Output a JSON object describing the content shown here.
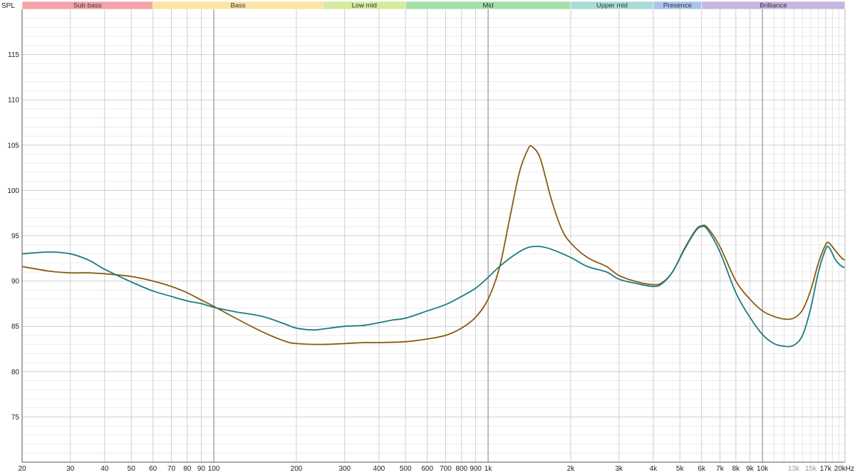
{
  "chart_data": {
    "type": "line",
    "ylabel": "SPL",
    "x_scale": "log",
    "xlim": [
      20,
      20000
    ],
    "ylim": [
      70,
      120
    ],
    "y_major_ticks": [
      75,
      80,
      85,
      90,
      95,
      100,
      105,
      110,
      115
    ],
    "x_tick_labels": [
      {
        "value": 20,
        "label": "20"
      },
      {
        "value": 30,
        "label": "30"
      },
      {
        "value": 40,
        "label": "40"
      },
      {
        "value": 50,
        "label": "50"
      },
      {
        "value": 60,
        "label": "60"
      },
      {
        "value": 70,
        "label": "70"
      },
      {
        "value": 80,
        "label": "80"
      },
      {
        "value": 90,
        "label": "90"
      },
      {
        "value": 100,
        "label": "100"
      },
      {
        "value": 200,
        "label": "200"
      },
      {
        "value": 300,
        "label": "300"
      },
      {
        "value": 400,
        "label": "400"
      },
      {
        "value": 500,
        "label": "500"
      },
      {
        "value": 600,
        "label": "600"
      },
      {
        "value": 700,
        "label": "700"
      },
      {
        "value": 800,
        "label": "800"
      },
      {
        "value": 900,
        "label": "900"
      },
      {
        "value": 1000,
        "label": "1k"
      },
      {
        "value": 2000,
        "label": "2k"
      },
      {
        "value": 3000,
        "label": "3k"
      },
      {
        "value": 4000,
        "label": "4k"
      },
      {
        "value": 5000,
        "label": "5k"
      },
      {
        "value": 6000,
        "label": "6k"
      },
      {
        "value": 7000,
        "label": "7k"
      },
      {
        "value": 8000,
        "label": "8k"
      },
      {
        "value": 9000,
        "label": "9k"
      },
      {
        "value": 10000,
        "label": "10k"
      },
      {
        "value": 13000,
        "label": "13k",
        "faint": true
      },
      {
        "value": 15000,
        "label": "15k",
        "faint": true
      },
      {
        "value": 17000,
        "label": "17k"
      },
      {
        "value": 20000,
        "label": "20kHz"
      }
    ],
    "bands": [
      {
        "label": "Sub bass",
        "from": 20,
        "to": 60,
        "color": "#f5a3a8"
      },
      {
        "label": "Bass",
        "from": 60,
        "to": 250,
        "color": "#fbe4a6"
      },
      {
        "label": "Low mid",
        "from": 250,
        "to": 500,
        "color": "#d3ec9e"
      },
      {
        "label": "Mid",
        "from": 500,
        "to": 2000,
        "color": "#a5e0a9"
      },
      {
        "label": "Upper mid",
        "from": 2000,
        "to": 4000,
        "color": "#a8dcd6"
      },
      {
        "label": "Presence",
        "from": 4000,
        "to": 6000,
        "color": "#a9c3ea"
      },
      {
        "label": "Brilliance",
        "from": 6000,
        "to": 20000,
        "color": "#c6b6e0"
      }
    ],
    "grid": true,
    "series": [
      {
        "color": "#8a5a12",
        "points": [
          [
            20,
            91.6
          ],
          [
            25,
            91.1
          ],
          [
            30,
            90.9
          ],
          [
            35,
            90.9
          ],
          [
            40,
            90.8
          ],
          [
            50,
            90.5
          ],
          [
            60,
            90.0
          ],
          [
            70,
            89.4
          ],
          [
            80,
            88.7
          ],
          [
            90,
            87.9
          ],
          [
            100,
            87.2
          ],
          [
            120,
            85.9
          ],
          [
            150,
            84.4
          ],
          [
            180,
            83.4
          ],
          [
            200,
            83.1
          ],
          [
            250,
            83.0
          ],
          [
            300,
            83.1
          ],
          [
            350,
            83.2
          ],
          [
            400,
            83.2
          ],
          [
            500,
            83.3
          ],
          [
            600,
            83.6
          ],
          [
            700,
            84.0
          ],
          [
            800,
            84.8
          ],
          [
            900,
            86.0
          ],
          [
            1000,
            88.0
          ],
          [
            1100,
            91.5
          ],
          [
            1200,
            97.0
          ],
          [
            1300,
            102.0
          ],
          [
            1400,
            104.6
          ],
          [
            1450,
            104.8
          ],
          [
            1550,
            103.5
          ],
          [
            1700,
            99.0
          ],
          [
            1850,
            95.8
          ],
          [
            2000,
            94.2
          ],
          [
            2300,
            92.6
          ],
          [
            2700,
            91.6
          ],
          [
            3000,
            90.6
          ],
          [
            3500,
            89.9
          ],
          [
            4000,
            89.6
          ],
          [
            4300,
            89.8
          ],
          [
            4700,
            91.0
          ],
          [
            5200,
            93.6
          ],
          [
            5700,
            95.6
          ],
          [
            6000,
            96.1
          ],
          [
            6300,
            95.9
          ],
          [
            7000,
            93.8
          ],
          [
            8000,
            90.0
          ],
          [
            9000,
            88.0
          ],
          [
            10000,
            86.7
          ],
          [
            11000,
            86.1
          ],
          [
            12000,
            85.8
          ],
          [
            13000,
            85.9
          ],
          [
            14000,
            86.8
          ],
          [
            15000,
            89.0
          ],
          [
            16000,
            92.0
          ],
          [
            17000,
            94.0
          ],
          [
            17500,
            94.2
          ],
          [
            18500,
            93.3
          ],
          [
            19500,
            92.5
          ],
          [
            20000,
            92.3
          ]
        ]
      },
      {
        "color": "#1b7c7e",
        "points": [
          [
            20,
            93.0
          ],
          [
            25,
            93.2
          ],
          [
            30,
            93.0
          ],
          [
            35,
            92.3
          ],
          [
            40,
            91.3
          ],
          [
            50,
            89.9
          ],
          [
            60,
            88.9
          ],
          [
            70,
            88.3
          ],
          [
            80,
            87.8
          ],
          [
            90,
            87.5
          ],
          [
            100,
            87.1
          ],
          [
            120,
            86.6
          ],
          [
            150,
            86.1
          ],
          [
            180,
            85.3
          ],
          [
            200,
            84.8
          ],
          [
            230,
            84.6
          ],
          [
            250,
            84.7
          ],
          [
            300,
            85.0
          ],
          [
            350,
            85.1
          ],
          [
            400,
            85.4
          ],
          [
            450,
            85.7
          ],
          [
            500,
            85.9
          ],
          [
            600,
            86.7
          ],
          [
            700,
            87.4
          ],
          [
            800,
            88.3
          ],
          [
            900,
            89.2
          ],
          [
            1000,
            90.4
          ],
          [
            1100,
            91.6
          ],
          [
            1250,
            92.9
          ],
          [
            1400,
            93.7
          ],
          [
            1550,
            93.8
          ],
          [
            1700,
            93.5
          ],
          [
            2000,
            92.6
          ],
          [
            2300,
            91.6
          ],
          [
            2700,
            91.0
          ],
          [
            3000,
            90.2
          ],
          [
            3500,
            89.7
          ],
          [
            4000,
            89.4
          ],
          [
            4300,
            89.7
          ],
          [
            4700,
            91.0
          ],
          [
            5200,
            93.5
          ],
          [
            5700,
            95.5
          ],
          [
            6000,
            96.0
          ],
          [
            6300,
            95.7
          ],
          [
            7000,
            93.2
          ],
          [
            8000,
            88.7
          ],
          [
            9000,
            86.0
          ],
          [
            10000,
            84.1
          ],
          [
            11000,
            83.1
          ],
          [
            12000,
            82.8
          ],
          [
            13000,
            82.9
          ],
          [
            14000,
            84.0
          ],
          [
            15000,
            87.0
          ],
          [
            16000,
            91.0
          ],
          [
            17000,
            93.5
          ],
          [
            17500,
            93.7
          ],
          [
            18500,
            92.3
          ],
          [
            19500,
            91.6
          ],
          [
            20000,
            91.5
          ]
        ]
      }
    ]
  }
}
